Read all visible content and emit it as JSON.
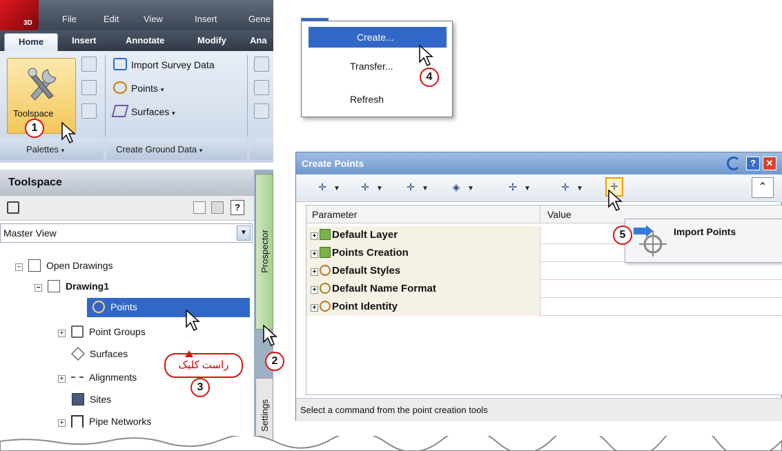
{
  "ribbon": {
    "logo_text": "3D",
    "menus": [
      "File",
      "Edit",
      "View",
      "Insert",
      "Gene"
    ],
    "tabs": [
      "Home",
      "Insert",
      "Annotate",
      "Modify",
      "Ana"
    ],
    "toolspace_label": "Toolspace",
    "rows": [
      "Import Survey Data",
      "Points",
      "Surfaces"
    ],
    "panel_palettes": "Palettes",
    "panel_ground": "Create Ground Data"
  },
  "context_menu": {
    "items": [
      "Create...",
      "Transfer...",
      "Refresh"
    ]
  },
  "toolspace": {
    "title": "Toolspace",
    "view": "Master View",
    "tree": {
      "open_drawings": "Open Drawings",
      "drawing": "Drawing1",
      "points": "Points",
      "point_groups": "Point Groups",
      "surfaces": "Surfaces",
      "alignments": "Alignments",
      "sites": "Sites",
      "pipe_networks": "Pipe Networks"
    },
    "side_tabs": {
      "prospector": "Prospector",
      "settings": "Settings"
    }
  },
  "create_points": {
    "title": "Create Points",
    "columns": [
      "Parameter",
      "Value"
    ],
    "rows": [
      "Default Layer",
      "Points Creation",
      "Default Styles",
      "Default Name Format",
      "Point Identity"
    ],
    "tooltip": "Import Points",
    "status": "Select a command from the point creation tools"
  },
  "callouts": {
    "steps": [
      "1",
      "2",
      "3",
      "4",
      "5"
    ],
    "right_click_note": "راست کلیک"
  },
  "colors": {
    "accent": "#3168c7",
    "callout": "#dd1111",
    "prospector_tab": "#a7cf92"
  }
}
